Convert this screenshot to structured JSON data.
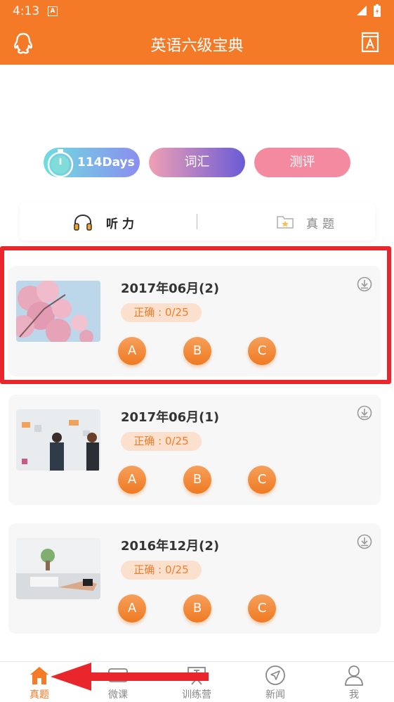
{
  "status_bar": {
    "time": "4:13",
    "notification_icon": "A"
  },
  "app_bar": {
    "title": "英语六级宝典",
    "left_icon": "qq-penguin-icon",
    "right_icon": "dictionary-icon"
  },
  "pills": {
    "days": "114Days",
    "vocab": "词汇",
    "eval": "测评"
  },
  "tabs": {
    "listen": "听力",
    "real": "真题"
  },
  "cards": [
    {
      "title": "2017年06月(2)",
      "badge": "正确 : 0/25",
      "options": [
        "A",
        "B",
        "C"
      ]
    },
    {
      "title": "2017年06月(1)",
      "badge": "正确 : 0/25",
      "options": [
        "A",
        "B",
        "C"
      ]
    },
    {
      "title": "2016年12月(2)",
      "badge": "正确 : 0/25",
      "options": [
        "A",
        "B",
        "C"
      ]
    }
  ],
  "nav": [
    {
      "label": "真题",
      "active": true
    },
    {
      "label": "微课"
    },
    {
      "label": "训练营"
    },
    {
      "label": "新闻"
    },
    {
      "label": "我"
    }
  ],
  "colors": {
    "accent": "#f47a28",
    "highlight": "#e8262b",
    "badge_bg": "#fbe0cd"
  }
}
